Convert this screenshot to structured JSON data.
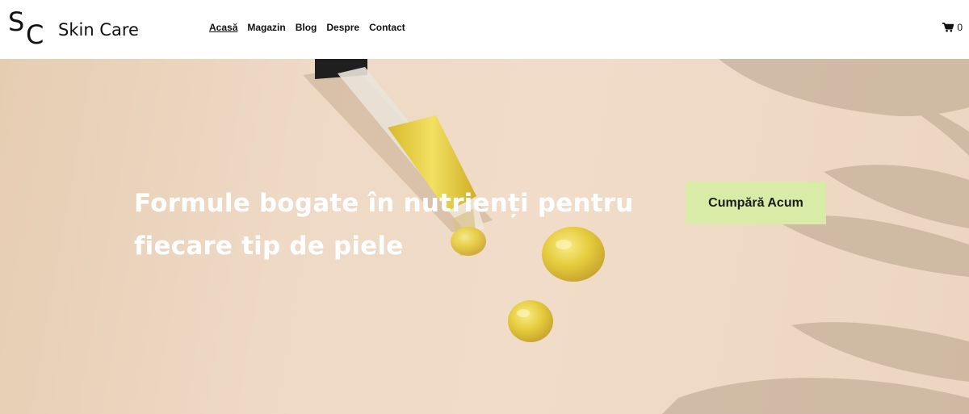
{
  "brand": {
    "mark_s": "S",
    "mark_c": "C",
    "name": "Skin Care"
  },
  "nav": {
    "items": [
      {
        "label": "Acasă",
        "active": true
      },
      {
        "label": "Magazin",
        "active": false
      },
      {
        "label": "Blog",
        "active": false
      },
      {
        "label": "Despre",
        "active": false
      },
      {
        "label": "Contact",
        "active": false
      }
    ]
  },
  "cart": {
    "icon": "cart-icon",
    "count": "0"
  },
  "hero": {
    "title": "Formule bogate în nutrienți pentru fiecare tip de piele",
    "cta_label": "Cumpără Acum"
  },
  "colors": {
    "cta_background": "#d8eca8",
    "hero_text": "#ffffff",
    "hero_background": "#efd9c4"
  }
}
